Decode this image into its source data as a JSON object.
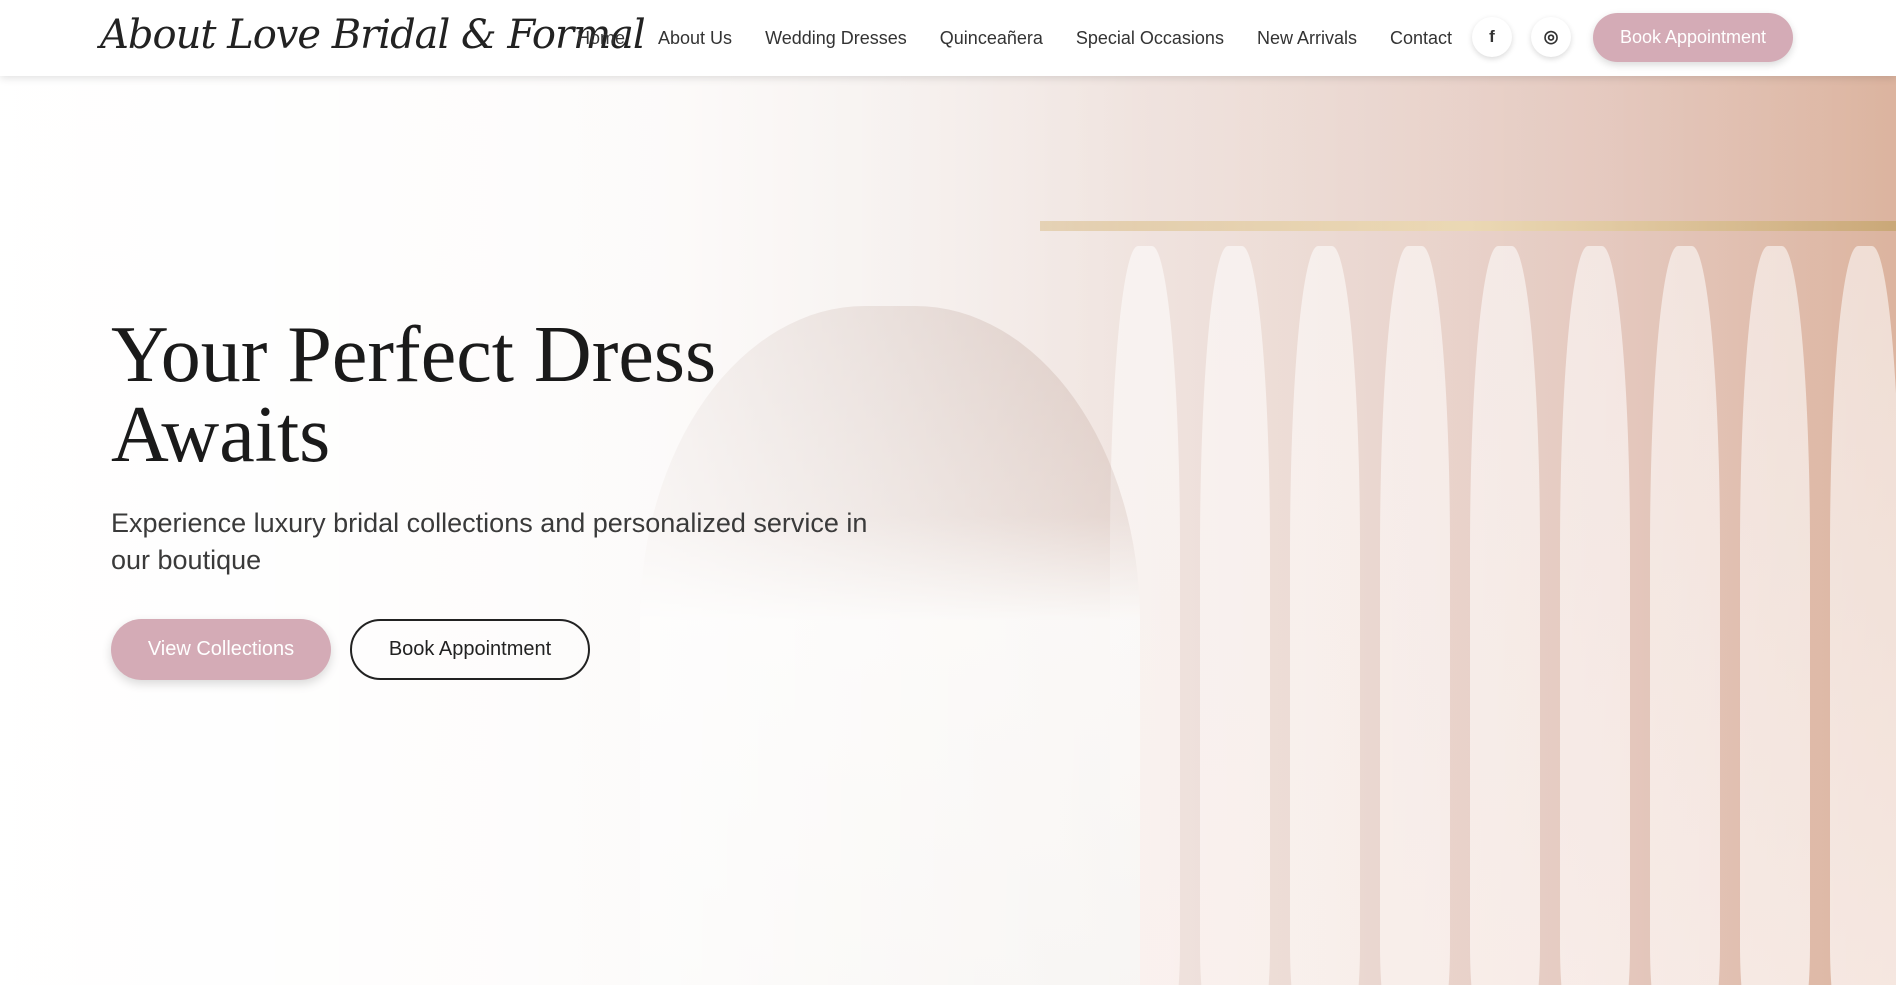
{
  "header": {
    "logo": "About Love Bridal & Formal",
    "nav": [
      "Home",
      "About Us",
      "Wedding Dresses",
      "Quinceañera",
      "Special Occasions",
      "New Arrivals",
      "Contact"
    ],
    "facebook_icon": "f",
    "instagram_icon": "◎",
    "book_label": "Book Appointment"
  },
  "hero": {
    "title": "Your Perfect Dress Awaits",
    "subtitle": "Experience luxury bridal collections and personalized service in our boutique",
    "primary_label": "View Collections",
    "secondary_label": "Book Appointment"
  },
  "colors": {
    "accent": "#d4abb6"
  }
}
